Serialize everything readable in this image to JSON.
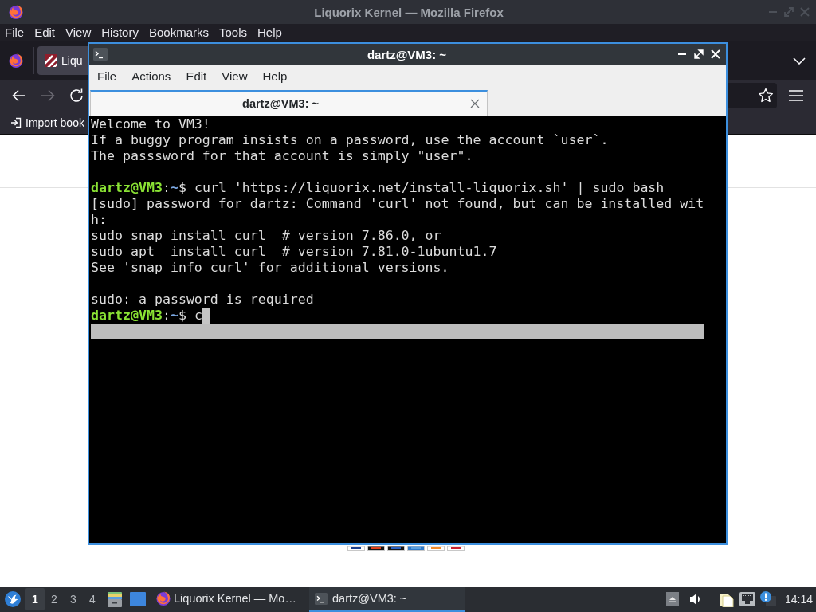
{
  "firefox": {
    "title": "Liquorix Kernel — Mozilla Firefox",
    "menu": [
      "File",
      "Edit",
      "View",
      "History",
      "Bookmarks",
      "Tools",
      "Help"
    ],
    "tabs": [
      {
        "label": "Liqu",
        "selected": true
      }
    ],
    "nav_buttons": [
      {
        "kind": "back",
        "disabled": false
      },
      {
        "kind": "forward",
        "disabled": true
      },
      {
        "kind": "reload",
        "disabled": false
      }
    ],
    "bookmarks": [
      {
        "label": "Import book"
      }
    ]
  },
  "terminal": {
    "title": "dartz@VM3: ~",
    "menu": [
      "File",
      "Actions",
      "Edit",
      "View",
      "Help"
    ],
    "tabs": [
      {
        "label": "dartz@VM3: ~",
        "selected": true
      }
    ],
    "lines": [
      {
        "kind": "output",
        "text": "Welcome to VM3!"
      },
      {
        "kind": "output",
        "text": "If a buggy program insists on a password, use the account `user`."
      },
      {
        "kind": "output",
        "text": "The passsword for that account is simply \"user\"."
      },
      {
        "kind": "blank"
      },
      {
        "kind": "prompt",
        "user_host": "dartz@VM3",
        "separator": ":",
        "path": "~",
        "symbol": "$",
        "command": "curl 'https://liquorix.net/install-liquorix.sh' | sudo bash",
        "cursor": false
      },
      {
        "kind": "output",
        "text": "[sudo] password for dartz: Command 'curl' not found, but can be installed wit"
      },
      {
        "kind": "output",
        "text": "h:"
      },
      {
        "kind": "output",
        "text": "sudo snap install curl  # version 7.86.0, or"
      },
      {
        "kind": "output",
        "text": "sudo apt  install curl  # version 7.81.0-1ubuntu1.7"
      },
      {
        "kind": "output",
        "text": "See 'snap info curl' for additional versions."
      },
      {
        "kind": "blank"
      },
      {
        "kind": "output",
        "text": "sudo: a password is required"
      },
      {
        "kind": "prompt",
        "user_host": "dartz@VM3",
        "separator": ":",
        "path": "~",
        "symbol": "$",
        "command": "c",
        "cursor": true
      }
    ]
  },
  "taskbar": {
    "workspaces": [
      {
        "label": "1",
        "selected": true
      },
      {
        "label": "2",
        "selected": false
      },
      {
        "label": "3",
        "selected": false
      },
      {
        "label": "4",
        "selected": false
      }
    ],
    "tasks": [
      {
        "kind": "browser",
        "label": "Liquorix Kernel — Mo…",
        "selected": false
      },
      {
        "kind": "terminal",
        "label": "dartz@VM3: ~",
        "selected": true
      }
    ],
    "clock": "14:14"
  }
}
